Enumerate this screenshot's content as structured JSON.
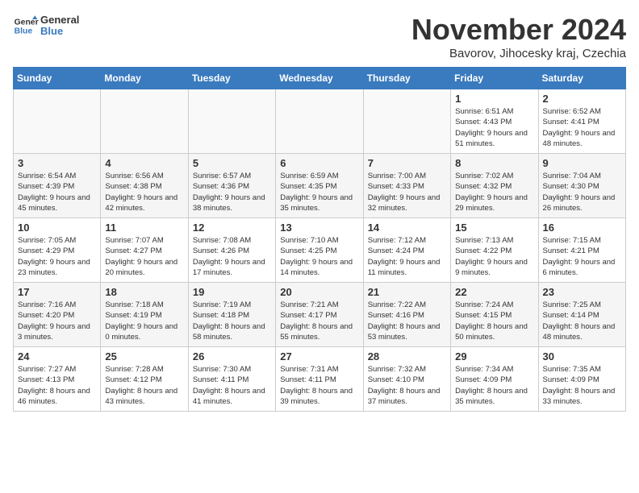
{
  "header": {
    "logo_line1": "General",
    "logo_line2": "Blue",
    "month_title": "November 2024",
    "subtitle": "Bavorov, Jihocesky kraj, Czechia"
  },
  "weekdays": [
    "Sunday",
    "Monday",
    "Tuesday",
    "Wednesday",
    "Thursday",
    "Friday",
    "Saturday"
  ],
  "weeks": [
    [
      {
        "day": "",
        "info": ""
      },
      {
        "day": "",
        "info": ""
      },
      {
        "day": "",
        "info": ""
      },
      {
        "day": "",
        "info": ""
      },
      {
        "day": "",
        "info": ""
      },
      {
        "day": "1",
        "info": "Sunrise: 6:51 AM\nSunset: 4:43 PM\nDaylight: 9 hours and 51 minutes."
      },
      {
        "day": "2",
        "info": "Sunrise: 6:52 AM\nSunset: 4:41 PM\nDaylight: 9 hours and 48 minutes."
      }
    ],
    [
      {
        "day": "3",
        "info": "Sunrise: 6:54 AM\nSunset: 4:39 PM\nDaylight: 9 hours and 45 minutes."
      },
      {
        "day": "4",
        "info": "Sunrise: 6:56 AM\nSunset: 4:38 PM\nDaylight: 9 hours and 42 minutes."
      },
      {
        "day": "5",
        "info": "Sunrise: 6:57 AM\nSunset: 4:36 PM\nDaylight: 9 hours and 38 minutes."
      },
      {
        "day": "6",
        "info": "Sunrise: 6:59 AM\nSunset: 4:35 PM\nDaylight: 9 hours and 35 minutes."
      },
      {
        "day": "7",
        "info": "Sunrise: 7:00 AM\nSunset: 4:33 PM\nDaylight: 9 hours and 32 minutes."
      },
      {
        "day": "8",
        "info": "Sunrise: 7:02 AM\nSunset: 4:32 PM\nDaylight: 9 hours and 29 minutes."
      },
      {
        "day": "9",
        "info": "Sunrise: 7:04 AM\nSunset: 4:30 PM\nDaylight: 9 hours and 26 minutes."
      }
    ],
    [
      {
        "day": "10",
        "info": "Sunrise: 7:05 AM\nSunset: 4:29 PM\nDaylight: 9 hours and 23 minutes."
      },
      {
        "day": "11",
        "info": "Sunrise: 7:07 AM\nSunset: 4:27 PM\nDaylight: 9 hours and 20 minutes."
      },
      {
        "day": "12",
        "info": "Sunrise: 7:08 AM\nSunset: 4:26 PM\nDaylight: 9 hours and 17 minutes."
      },
      {
        "day": "13",
        "info": "Sunrise: 7:10 AM\nSunset: 4:25 PM\nDaylight: 9 hours and 14 minutes."
      },
      {
        "day": "14",
        "info": "Sunrise: 7:12 AM\nSunset: 4:24 PM\nDaylight: 9 hours and 11 minutes."
      },
      {
        "day": "15",
        "info": "Sunrise: 7:13 AM\nSunset: 4:22 PM\nDaylight: 9 hours and 9 minutes."
      },
      {
        "day": "16",
        "info": "Sunrise: 7:15 AM\nSunset: 4:21 PM\nDaylight: 9 hours and 6 minutes."
      }
    ],
    [
      {
        "day": "17",
        "info": "Sunrise: 7:16 AM\nSunset: 4:20 PM\nDaylight: 9 hours and 3 minutes."
      },
      {
        "day": "18",
        "info": "Sunrise: 7:18 AM\nSunset: 4:19 PM\nDaylight: 9 hours and 0 minutes."
      },
      {
        "day": "19",
        "info": "Sunrise: 7:19 AM\nSunset: 4:18 PM\nDaylight: 8 hours and 58 minutes."
      },
      {
        "day": "20",
        "info": "Sunrise: 7:21 AM\nSunset: 4:17 PM\nDaylight: 8 hours and 55 minutes."
      },
      {
        "day": "21",
        "info": "Sunrise: 7:22 AM\nSunset: 4:16 PM\nDaylight: 8 hours and 53 minutes."
      },
      {
        "day": "22",
        "info": "Sunrise: 7:24 AM\nSunset: 4:15 PM\nDaylight: 8 hours and 50 minutes."
      },
      {
        "day": "23",
        "info": "Sunrise: 7:25 AM\nSunset: 4:14 PM\nDaylight: 8 hours and 48 minutes."
      }
    ],
    [
      {
        "day": "24",
        "info": "Sunrise: 7:27 AM\nSunset: 4:13 PM\nDaylight: 8 hours and 46 minutes."
      },
      {
        "day": "25",
        "info": "Sunrise: 7:28 AM\nSunset: 4:12 PM\nDaylight: 8 hours and 43 minutes."
      },
      {
        "day": "26",
        "info": "Sunrise: 7:30 AM\nSunset: 4:11 PM\nDaylight: 8 hours and 41 minutes."
      },
      {
        "day": "27",
        "info": "Sunrise: 7:31 AM\nSunset: 4:11 PM\nDaylight: 8 hours and 39 minutes."
      },
      {
        "day": "28",
        "info": "Sunrise: 7:32 AM\nSunset: 4:10 PM\nDaylight: 8 hours and 37 minutes."
      },
      {
        "day": "29",
        "info": "Sunrise: 7:34 AM\nSunset: 4:09 PM\nDaylight: 8 hours and 35 minutes."
      },
      {
        "day": "30",
        "info": "Sunrise: 7:35 AM\nSunset: 4:09 PM\nDaylight: 8 hours and 33 minutes."
      }
    ]
  ]
}
